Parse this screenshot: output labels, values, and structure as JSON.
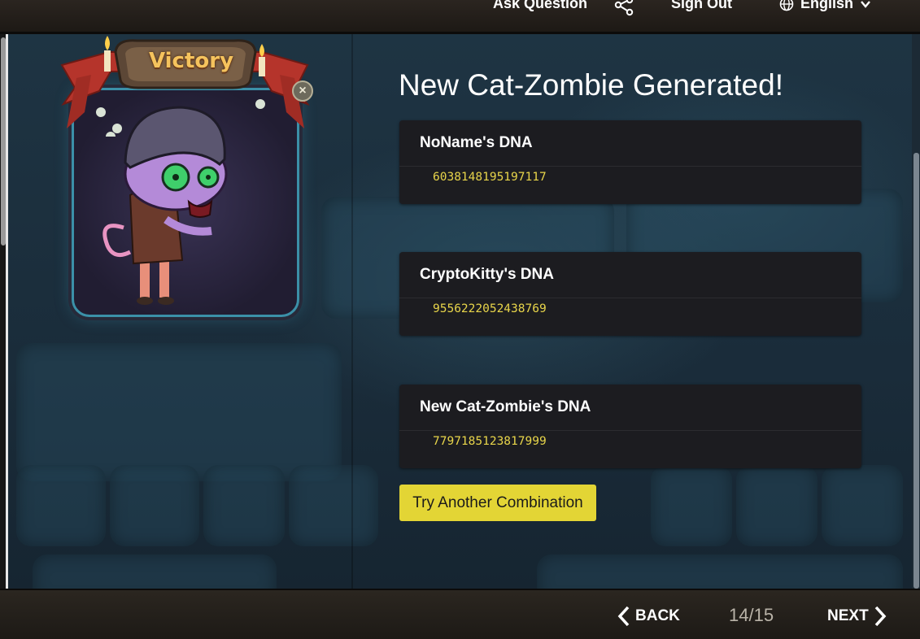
{
  "header": {
    "ask_question": "Ask Question",
    "share_icon": "share-icon",
    "sign_out": "Sign Out",
    "language": "English"
  },
  "victory_card": {
    "banner_text": "Victory",
    "close_icon": "close-icon"
  },
  "content": {
    "heading": "New Cat-Zombie Generated!",
    "dna_cards": [
      {
        "title": "NoName's DNA",
        "value": "6038148195197117"
      },
      {
        "title": "CryptoKitty's DNA",
        "value": "9556222052438769"
      },
      {
        "title": "New Cat-Zombie's DNA",
        "value": "7797185123817999"
      }
    ],
    "try_button": "Try Another Combination"
  },
  "footer": {
    "back": "BACK",
    "page": "14/15",
    "next": "NEXT"
  },
  "colors": {
    "accent_yellow": "#e3d535",
    "dna_value": "#e8d54a",
    "card_bg": "#1c1c20"
  }
}
